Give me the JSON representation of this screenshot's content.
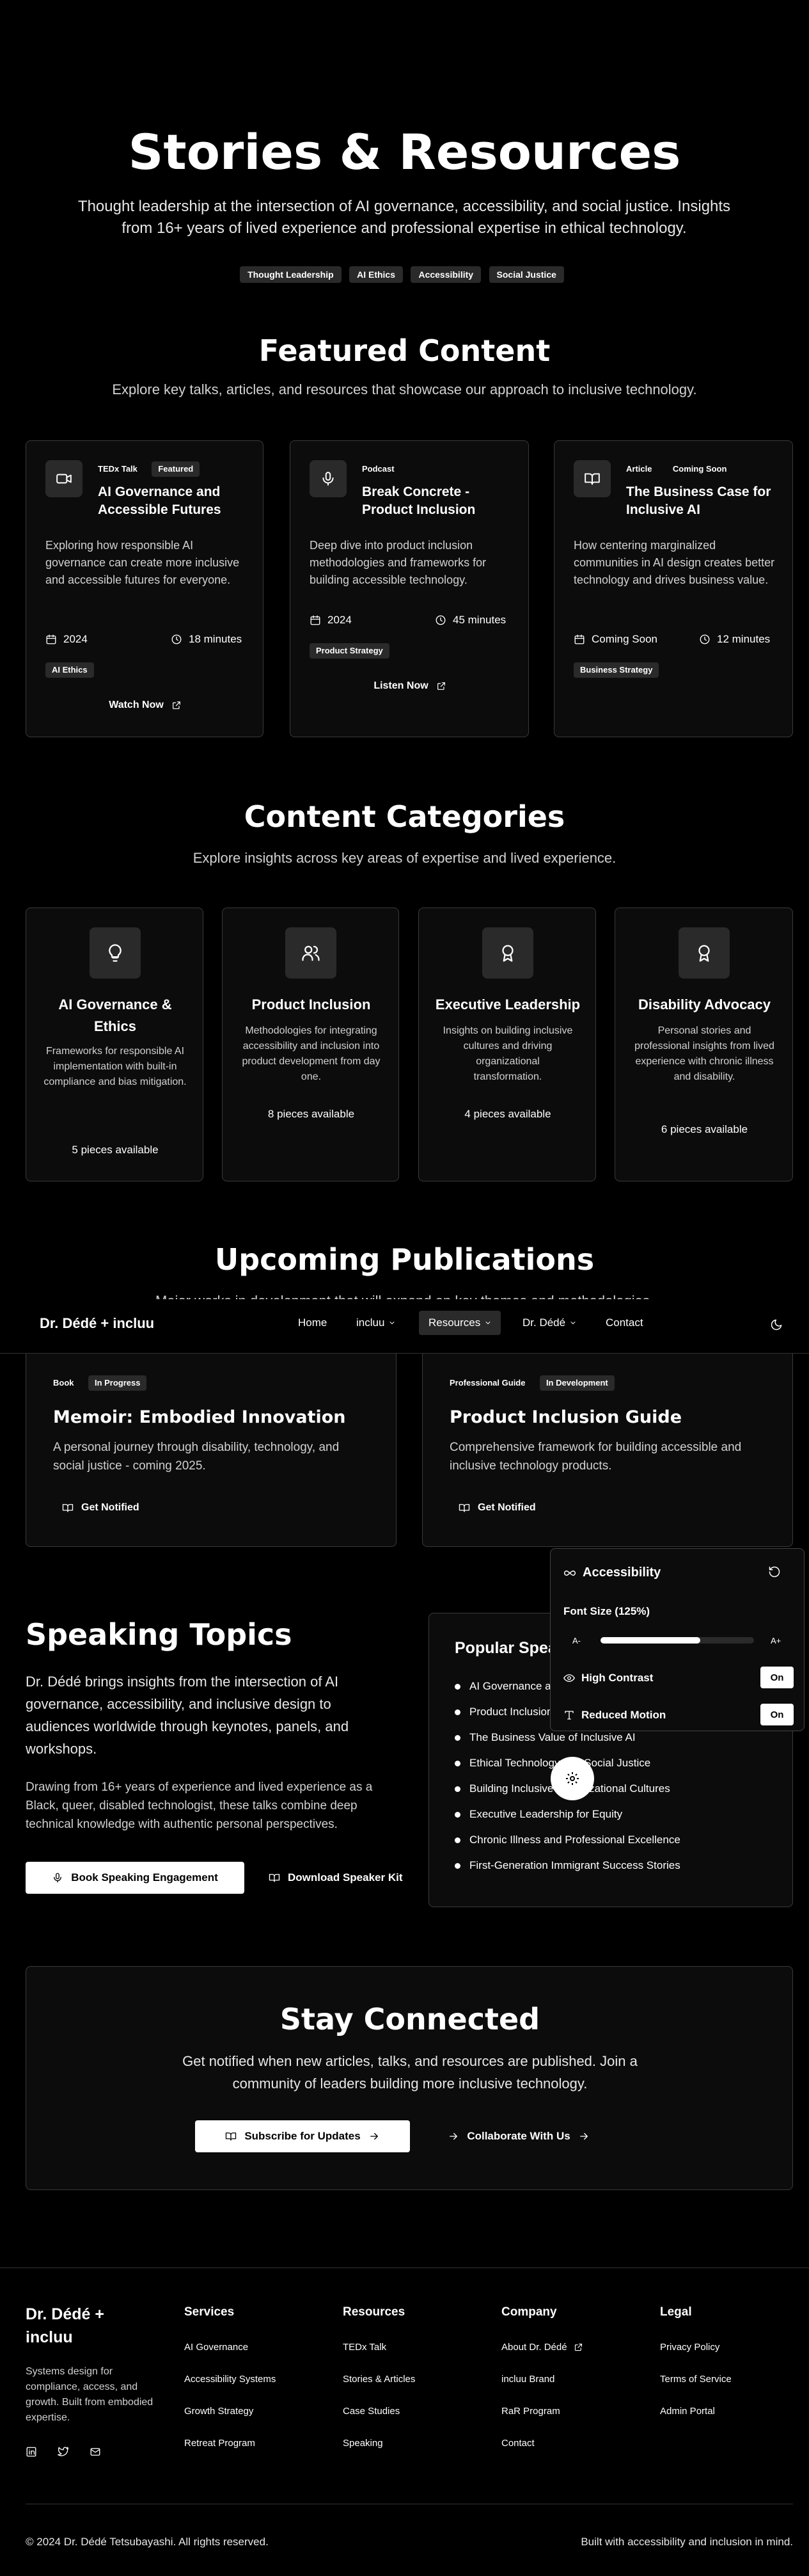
{
  "hero": {
    "title": "Stories & Resources",
    "subtitle": "Thought leadership at the intersection of AI governance, accessibility, and social justice. Insights from 16+ years of lived experience and professional expertise in ethical technology.",
    "tags": [
      "Thought Leadership",
      "AI Ethics",
      "Accessibility",
      "Social Justice"
    ]
  },
  "featured": {
    "title": "Featured Content",
    "subtitle": "Explore key talks, articles, and resources that showcase our approach to inclusive technology.",
    "cards": [
      {
        "icon": "video-icon",
        "type": "TEDx Talk",
        "badge": "Featured",
        "title": "AI Governance and Accessible Futures",
        "desc": "Exploring how responsible AI governance can create more inclusive and accessible futures for everyone.",
        "date": "2024",
        "duration": "18 minutes",
        "topic": "AI Ethics",
        "action": "Watch Now"
      },
      {
        "icon": "mic-icon",
        "type": "Podcast",
        "badge": "",
        "title": "Break Concrete - Product Inclusion",
        "desc": "Deep dive into product inclusion methodologies and frameworks for building accessible technology.",
        "date": "2024",
        "duration": "45 minutes",
        "topic": "Product Strategy",
        "action": "Listen Now"
      },
      {
        "icon": "book-open-icon",
        "type": "Article",
        "badge": "Coming Soon",
        "title": "The Business Case for Inclusive AI",
        "desc": "How centering marginalized communities in AI design creates better technology and drives business value.",
        "date": "Coming Soon",
        "duration": "12 minutes",
        "topic": "Business Strategy",
        "action": ""
      }
    ]
  },
  "categories": {
    "title": "Content Categories",
    "subtitle": "Explore insights across key areas of expertise and lived experience.",
    "items": [
      {
        "icon": "lightbulb-icon",
        "title": "AI Governance & Ethics",
        "desc": "Frameworks for responsible AI implementation with built-in compliance and bias mitigation.",
        "count": "5 pieces available"
      },
      {
        "icon": "users-icon",
        "title": "Product Inclusion",
        "desc": "Methodologies for integrating accessibility and inclusion into product development from day one.",
        "count": "8 pieces available"
      },
      {
        "icon": "award-icon",
        "title": "Executive Leadership",
        "desc": "Insights on building inclusive cultures and driving organizational transformation.",
        "count": "4 pieces available"
      },
      {
        "icon": "award-icon",
        "title": "Disability Advocacy",
        "desc": "Personal stories and professional insights from lived experience with chronic illness and disability.",
        "count": "6 pieces available"
      }
    ]
  },
  "publications": {
    "title": "Upcoming Publications",
    "subtitle": "Major works in development that will expand on key themes and methodologies.",
    "items": [
      {
        "type": "Book",
        "status": "In Progress",
        "title": "Memoir: Embodied Innovation",
        "desc": "A personal journey through disability, technology, and social justice - coming 2025.",
        "action": "Get Notified"
      },
      {
        "type": "Professional Guide",
        "status": "In Development",
        "title": "Product Inclusion Guide",
        "desc": "Comprehensive framework for building accessible and inclusive technology products.",
        "action": "Get Notified"
      }
    ]
  },
  "nav": {
    "brand": "Dr. Dédé + incluu",
    "items": [
      "Home",
      "incluu",
      "Resources",
      "Dr. Dédé",
      "Contact"
    ]
  },
  "speaking": {
    "title": "Speaking Topics",
    "p1": "Dr. Dédé brings insights from the intersection of AI governance, accessibility, and inclusive design to audiences worldwide through keynotes, panels, and workshops.",
    "p2": "Drawing from 16+ years of experience and lived experience as a Black, queer, disabled technologist, these talks combine deep technical knowledge with authentic personal perspectives.",
    "book_button": "Book Speaking Engagement",
    "kit_button": "Download Speaker Kit",
    "popular_title": "Popular Speaking Topics",
    "topics": [
      "AI Governance and Accessible Futures",
      "Product Inclusion Frameworks",
      "The Business Value of Inclusive AI",
      "Ethical Technology and Social Justice",
      "Building Inclusive Organizational Cultures",
      "Executive Leadership for Equity",
      "Chronic Illness and Professional Excellence",
      "First-Generation Immigrant Success Stories"
    ]
  },
  "a11y": {
    "title": "Accessibility",
    "font_size_label": "Font Size (125%)",
    "font_size_value": 0.65,
    "decrease": "A-",
    "increase": "A+",
    "high_contrast": "High Contrast",
    "high_contrast_state": "On",
    "reduced_motion": "Reduced Motion",
    "reduced_motion_state": "On"
  },
  "connect": {
    "title": "Stay Connected",
    "subtitle": "Get notified when new articles, talks, and resources are published. Join a community of leaders building more inclusive technology.",
    "subscribe": "Subscribe for Updates",
    "collaborate": "Collaborate With Us"
  },
  "footer": {
    "brand": "Dr. Dédé + incluu",
    "about": "Systems design for compliance, access, and growth. Built from embodied expertise.",
    "columns": [
      {
        "title": "Services",
        "links": [
          "AI Governance",
          "Accessibility Systems",
          "Growth Strategy",
          "Retreat Program"
        ]
      },
      {
        "title": "Resources",
        "links": [
          "TEDx Talk",
          "Stories & Articles",
          "Case Studies",
          "Speaking"
        ]
      },
      {
        "title": "Company",
        "links": [
          "About Dr. Dédé",
          "incluu Brand",
          "RaR Program",
          "Contact"
        ]
      },
      {
        "title": "Legal",
        "links": [
          "Privacy Policy",
          "Terms of Service",
          "Admin Portal"
        ]
      }
    ],
    "copyright": "© 2024 Dr. Dédé Tetsubayashi. All rights reserved.",
    "tagline": "Built with accessibility and inclusion in mind."
  }
}
